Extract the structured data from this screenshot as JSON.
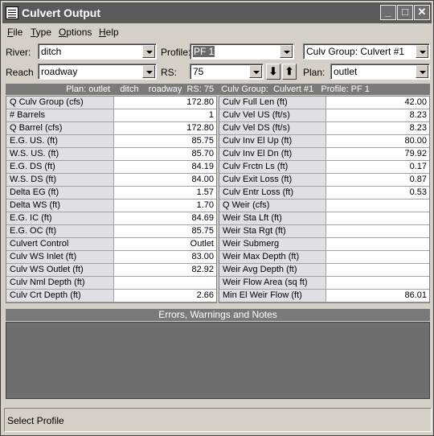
{
  "window": {
    "title": "Culvert Output"
  },
  "menu": [
    {
      "label": "File",
      "u": "F",
      "rest": "ile"
    },
    {
      "label": "Type",
      "u": "T",
      "rest": "ype"
    },
    {
      "label": "Options",
      "u": "O",
      "rest": "ptions"
    },
    {
      "label": "Help",
      "u": "H",
      "rest": "elp"
    }
  ],
  "selectors": {
    "river_label": "River:",
    "river_value": "ditch",
    "profile_label": "Profile:",
    "profile_value": "PF 1",
    "culv_group_value": "Culv Group:  Culvert #1",
    "reach_label": "Reach",
    "reach_value": "roadway",
    "rs_label": "RS:",
    "rs_value": "75",
    "plan_label": "Plan:",
    "plan_value": "outlet",
    "down_arrow": "⬇",
    "up_arrow": "⬆"
  },
  "header": "Plan: outlet    ditch    roadway  RS: 75   Culv Group:  Culvert #1   Profile: PF 1",
  "left_table": [
    {
      "k": "Q Culv Group (cfs)",
      "v": "172.80"
    },
    {
      "k": "# Barrels",
      "v": "1"
    },
    {
      "k": "Q Barrel (cfs)",
      "v": "172.80"
    },
    {
      "k": "E.G. US.  (ft)",
      "v": "85.75"
    },
    {
      "k": "W.S. US.  (ft)",
      "v": "85.70"
    },
    {
      "k": "E.G. DS (ft)",
      "v": "84.19"
    },
    {
      "k": "W.S. DS (ft)",
      "v": "84.00"
    },
    {
      "k": "Delta EG (ft)",
      "v": "1.57"
    },
    {
      "k": "Delta WS (ft)",
      "v": "1.70"
    },
    {
      "k": "E.G. IC (ft)",
      "v": "84.69"
    },
    {
      "k": "E.G. OC (ft)",
      "v": "85.75"
    },
    {
      "k": "Culvert Control",
      "v": "Outlet"
    },
    {
      "k": "Culv WS Inlet (ft)",
      "v": "83.00"
    },
    {
      "k": "Culv WS Outlet (ft)",
      "v": "82.92"
    },
    {
      "k": "Culv Nml Depth (ft)",
      "v": ""
    },
    {
      "k": "Culv Crt Depth (ft)",
      "v": "2.66"
    }
  ],
  "right_table": [
    {
      "k": "Culv Full Len (ft)",
      "v": "42.00"
    },
    {
      "k": "Culv Vel US (ft/s)",
      "v": "8.23"
    },
    {
      "k": "Culv Vel DS (ft/s)",
      "v": "8.23"
    },
    {
      "k": "Culv Inv El Up (ft)",
      "v": "80.00"
    },
    {
      "k": "Culv Inv El Dn (ft)",
      "v": "79.92"
    },
    {
      "k": "Culv Frctn Ls (ft)",
      "v": "0.17"
    },
    {
      "k": "Culv Exit Loss (ft)",
      "v": "0.87"
    },
    {
      "k": "Culv Entr Loss (ft)",
      "v": "0.53"
    },
    {
      "k": "Q Weir (cfs)",
      "v": ""
    },
    {
      "k": "Weir Sta Lft (ft)",
      "v": ""
    },
    {
      "k": "Weir Sta Rgt (ft)",
      "v": ""
    },
    {
      "k": "Weir Submerg",
      "v": ""
    },
    {
      "k": "Weir Max Depth (ft)",
      "v": ""
    },
    {
      "k": "Weir Avg Depth (ft)",
      "v": ""
    },
    {
      "k": "Weir Flow Area (sq ft)",
      "v": ""
    },
    {
      "k": "Min El Weir Flow (ft)",
      "v": "86.01"
    }
  ],
  "errors_title": "Errors, Warnings and Notes",
  "status": "Select Profile"
}
